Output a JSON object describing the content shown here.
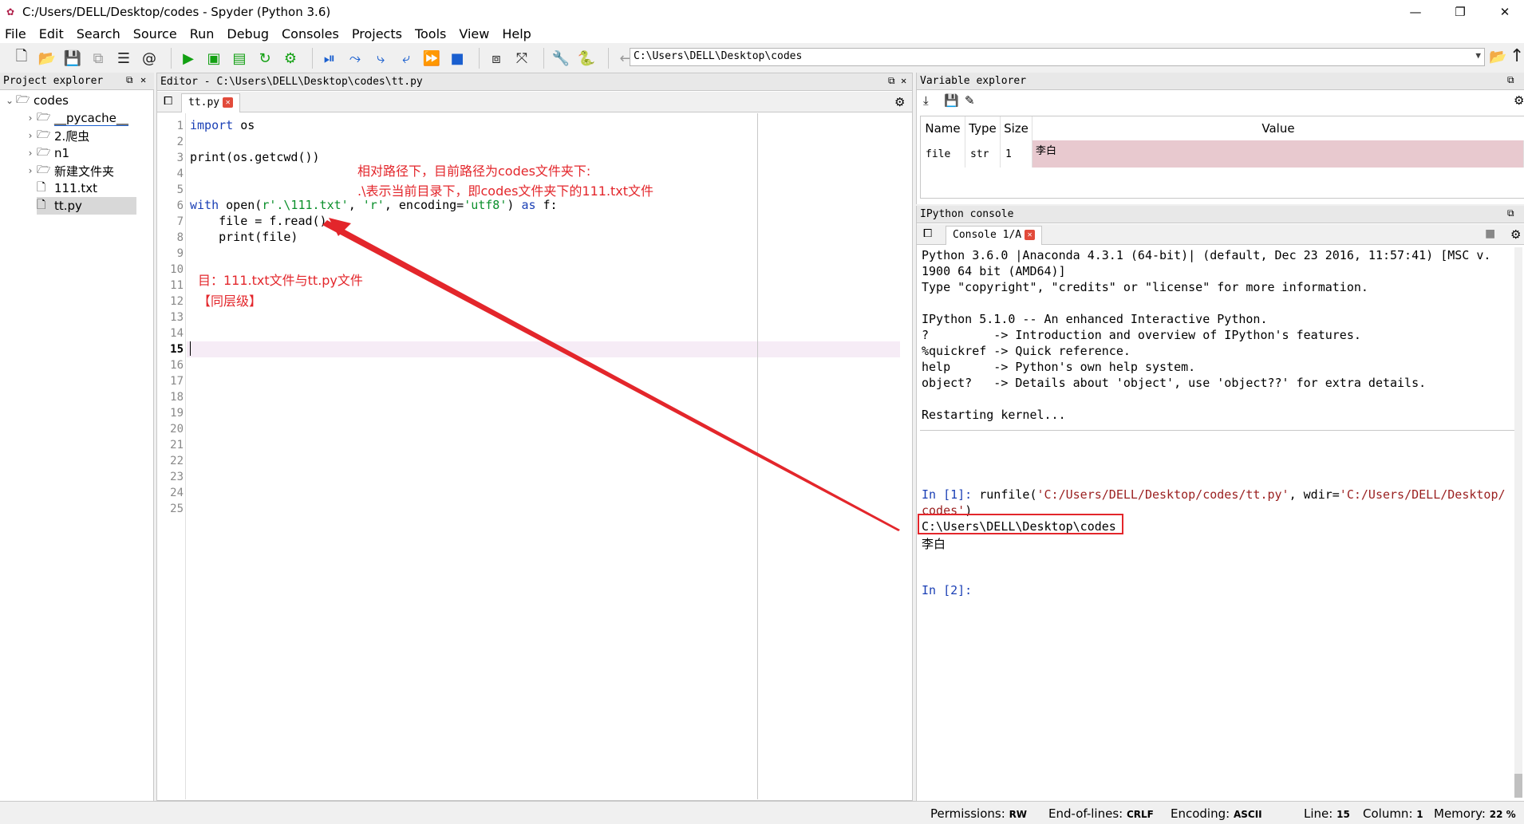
{
  "window": {
    "title": "C:/Users/DELL/Desktop/codes - Spyder (Python 3.6)"
  },
  "menu": [
    "File",
    "Edit",
    "Search",
    "Source",
    "Run",
    "Debug",
    "Consoles",
    "Projects",
    "Tools",
    "View",
    "Help"
  ],
  "toolbar": {
    "path": "C:\\Users\\DELL\\Desktop\\codes"
  },
  "project_explorer": {
    "title": "Project explorer",
    "root": "codes",
    "items": [
      "__pycache__",
      "2.爬虫",
      "n1",
      "新建文件夹",
      "111.txt",
      "tt.py"
    ]
  },
  "editor": {
    "title": "Editor - C:\\Users\\DELL\\Desktop\\codes\\tt.py",
    "tab": "tt.py",
    "current_line": 15,
    "line_count": 25
  },
  "annotations": {
    "a1": "相对路径下，目前路径为codes文件夹下:",
    "a2": ".\\表示当前目录下，即codes文件夹下的111.txt文件",
    "a3": "目：111.txt文件与tt.py文件",
    "a4": "【同层级】"
  },
  "variable_explorer": {
    "title": "Variable explorer",
    "headers": [
      "Name",
      "Type",
      "Size",
      "Value"
    ],
    "rows": [
      {
        "name": "file",
        "type": "str",
        "size": "1",
        "value": "李白"
      }
    ]
  },
  "console": {
    "title": "IPython console",
    "tab": "Console 1/A",
    "banner": [
      "Python 3.6.0 |Anaconda 4.3.1 (64-bit)| (default, Dec 23 2016, 11:57:41) [MSC v.",
      "1900 64 bit (AMD64)]",
      "Type \"copyright\", \"credits\" or \"license\" for more information.",
      "IPython 5.1.0 -- An enhanced Interactive Python.",
      "?         -> Introduction and overview of IPython's features.",
      "%quickref -> Quick reference.",
      "help      -> Python's own help system.",
      "object?   -> Details about 'object', use 'object??' for extra details.",
      "Restarting kernel..."
    ],
    "in1_prompt": "In [1]:",
    "in1_cmd": " runfile(",
    "in1_arg1": "'C:/Users/DELL/Desktop/codes/tt.py'",
    "in1_mid": ", wdir=",
    "in1_arg2": "'C:/Users/DELL/Desktop/",
    "in1_arg2b": "codes'",
    "in1_close": ")",
    "out_path": "C:\\Users\\DELL\\Desktop\\codes",
    "out_value": "李白",
    "in2_prompt": "In [2]:"
  },
  "status": {
    "permissions_label": "Permissions:",
    "permissions": "RW",
    "eol_label": "End-of-lines:",
    "eol": "CRLF",
    "encoding_label": "Encoding:",
    "encoding": "ASCII",
    "line_label": "Line:",
    "line": "15",
    "column_label": "Column:",
    "column": "1",
    "memory_label": "Memory:",
    "memory": "22 %"
  }
}
